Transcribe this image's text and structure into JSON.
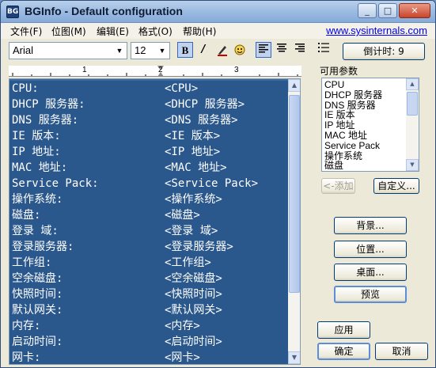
{
  "window": {
    "title": "BGInfo - Default configuration",
    "app_icon": "BG",
    "minimize_glyph": "_",
    "maximize_glyph": "□",
    "close_glyph": "✕"
  },
  "menu": {
    "items": [
      "文件(F)",
      "位图(M)",
      "编辑(E)",
      "格式(O)",
      "帮助(H)"
    ],
    "link": "www.sysinternals.com"
  },
  "toolbar": {
    "font": "Arial",
    "size": "12",
    "bold": "B",
    "italic": "/",
    "underline": "U",
    "countdown_button": "倒计时: 9"
  },
  "ruler": {
    "numbers": [
      "1",
      "2",
      "3"
    ]
  },
  "editor": {
    "rows": [
      [
        "CPU:",
        "<CPU>"
      ],
      [
        "DHCP 服务器:",
        "<DHCP 服务器>"
      ],
      [
        "DNS 服务器:",
        "<DNS 服务器>"
      ],
      [
        "IE 版本:",
        "<IE 版本>"
      ],
      [
        "IP 地址:",
        "<IP 地址>"
      ],
      [
        "MAC 地址:",
        "<MAC 地址>"
      ],
      [
        "Service Pack:",
        "<Service Pack>"
      ],
      [
        "操作系统:",
        "<操作系统>"
      ],
      [
        "磁盘:",
        "<磁盘>"
      ],
      [
        "登录 域:",
        "<登录 域>"
      ],
      [
        "登录服务器:",
        "<登录服务器>"
      ],
      [
        "工作组:",
        "<工作组>"
      ],
      [
        "空余磁盘:",
        "<空余磁盘>"
      ],
      [
        "快照时间:",
        "<快照时间>"
      ],
      [
        "默认网关:",
        "<默认网关>"
      ],
      [
        "内存:",
        "<内存>"
      ],
      [
        "启动时间:",
        "<启动时间>"
      ],
      [
        "网卡:",
        "<网卡>"
      ]
    ]
  },
  "fields": {
    "title": "可用参数",
    "items": [
      "CPU",
      "DHCP 服务器",
      "DNS 服务器",
      "IE 版本",
      "IP 地址",
      "MAC 地址",
      "Service Pack",
      "操作系统",
      "磁盘"
    ],
    "add_button": "<-添加",
    "custom_button": "自定义..."
  },
  "buttons": {
    "background": "背景...",
    "position": "位置...",
    "desktop": "桌面...",
    "preview": "预览",
    "apply": "应用",
    "ok": "确定",
    "cancel": "取消"
  },
  "colors": {
    "editor_background": "#2a578c",
    "title_bar": "#9fbde3",
    "window": "#ece9d8"
  }
}
